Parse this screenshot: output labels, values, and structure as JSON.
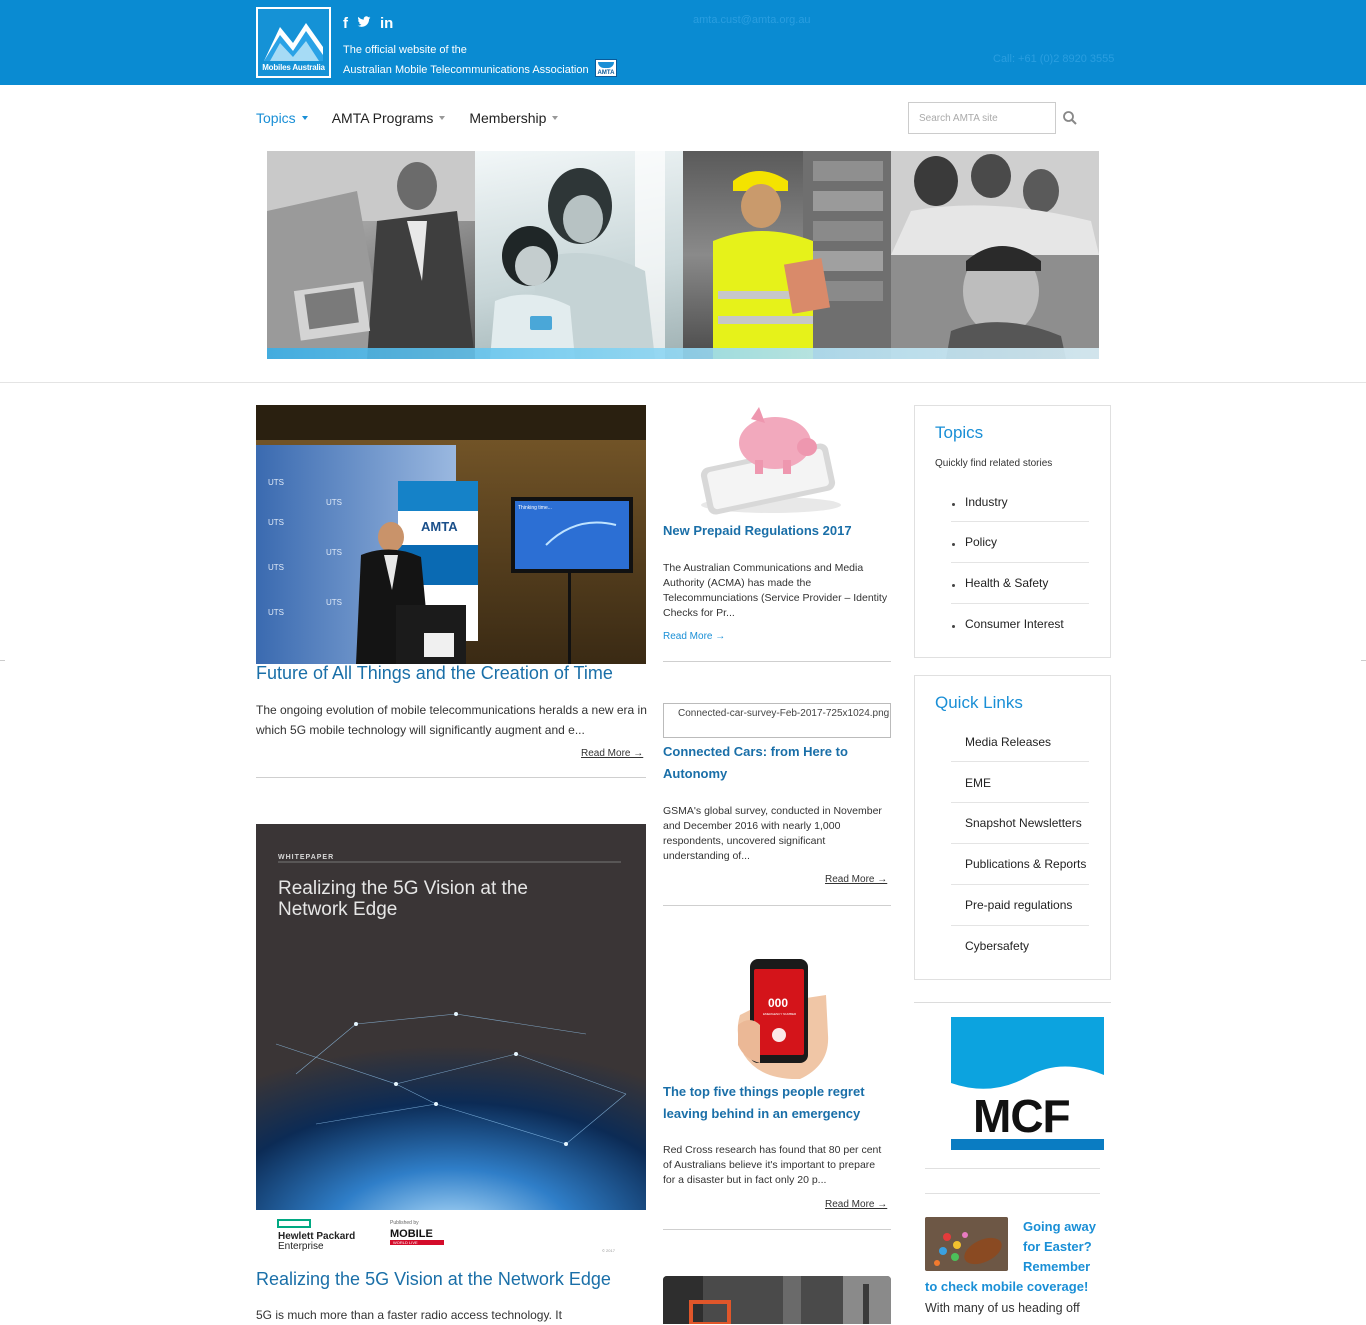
{
  "header": {
    "logo_text": "Mobiles Australia",
    "social": [
      "f",
      "t",
      "in"
    ],
    "social_icons": [
      "facebook-icon",
      "twitter-icon",
      "linkedin-icon"
    ],
    "tagline_line1": "The official website of the",
    "tagline_line2": "Australian Mobile Telecommunications Association",
    "badge": "AMTA",
    "email": "amta.cust@amta.org.au",
    "phone": "Call: +61 (0)2 8920 3555",
    "bg_color": "#0a8bd2"
  },
  "nav": {
    "items": [
      {
        "label": "Topics",
        "active": true
      },
      {
        "label": "AMTA Programs",
        "active": false
      },
      {
        "label": "Membership",
        "active": false
      }
    ],
    "search_placeholder": "Search AMTA site",
    "accent": "#1a8fd6"
  },
  "left": {
    "feature": {
      "title": "Future of All Things and the Creation of Time",
      "excerpt": "The ongoing evolution of mobile telecommunications heralds a new era in which 5G mobile technology will significantly augment and e...",
      "read_more": "Read More →",
      "image_text": {
        "amta": "AMTA",
        "uts": "UTS",
        "screen": "Thinking time..."
      }
    },
    "whitepaper": {
      "label": "WHITEPAPER",
      "cover_title_line1": "Realizing the 5G Vision at the",
      "cover_title_line2": "Network Edge",
      "hpe_line1": "Hewlett Packard",
      "hpe_line2": "Enterprise",
      "published_by": "Published by",
      "publisher": "MOBILE",
      "publisher_sub": "WORLD LIVE",
      "copyright": "© 2017",
      "title": "Realizing the 5G Vision at the Network Edge",
      "excerpt": "5G is much more than a faster radio access technology. It"
    }
  },
  "middle": {
    "articles": [
      {
        "title": "New Prepaid Regulations 2017",
        "excerpt": "The Australian Communications and Media Authority (ACMA) has made the Telecommunciations (Service Provider – Identity Checks for Pr...",
        "read_more": "Read More →"
      },
      {
        "image_alt": "Connected-car-survey-Feb-2017-725x1024.png",
        "title": "Connected Cars: from Here to Autonomy",
        "excerpt": "GSMA's global survey, conducted in November and December 2016 with nearly 1,000 respondents, uncovered significant understanding of...",
        "read_more": "Read More →"
      },
      {
        "title": "The top five things people regret leaving behind in an emergency",
        "excerpt": "Red Cross research has found that 80 per cent of Australians believe it's important to prepare for a disaster but in fact only 20 p...",
        "read_more": "Read More →",
        "phone_screen": "000",
        "phone_screen_sub": "EMERGENCY NUMBER"
      }
    ]
  },
  "sidebar": {
    "topics": {
      "title": "Topics",
      "subtitle": "Quickly find related stories",
      "items": [
        "Industry",
        "Policy",
        "Health & Safety",
        "Consumer Interest"
      ]
    },
    "quick_links": {
      "title": "Quick Links",
      "items": [
        "Media Releases",
        "EME",
        "Snapshot Newsletters",
        "Publications & Reports",
        "Pre-paid regulations",
        "Cybersafety"
      ]
    },
    "mcf_logo": "MCF",
    "easter": {
      "title_line1": "Going away",
      "title_line2": "for Easter?",
      "title_line3": "Remember",
      "title_line4": "to check mobile coverage!",
      "text": "With many of us heading off"
    }
  }
}
